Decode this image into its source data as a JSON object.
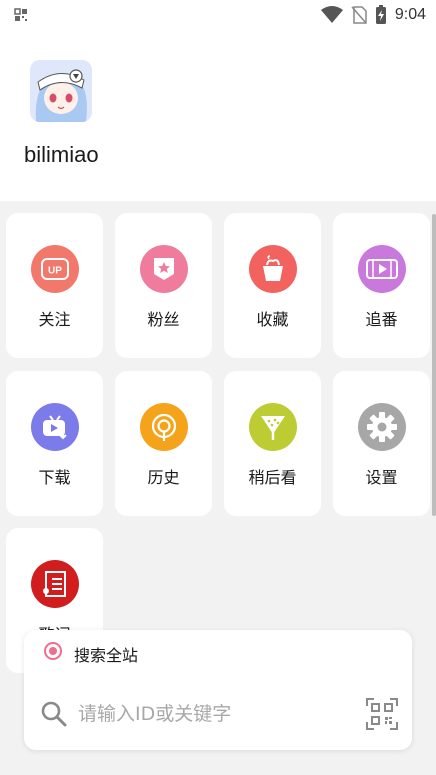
{
  "status_bar": {
    "time": "9:04"
  },
  "profile": {
    "username": "bilimiao"
  },
  "menu": [
    {
      "label": "关注",
      "icon": "up-icon",
      "color": "#f2786b"
    },
    {
      "label": "粉丝",
      "icon": "fans-badge-icon",
      "color": "#f07c9d"
    },
    {
      "label": "收藏",
      "icon": "collection-cup-icon",
      "color": "#f2635f"
    },
    {
      "label": "追番",
      "icon": "anime-film-icon",
      "color": "#c978dc"
    },
    {
      "label": "下载",
      "icon": "download-tv-icon",
      "color": "#7b7be9"
    },
    {
      "label": "历史",
      "icon": "history-icon",
      "color": "#f5a31a"
    },
    {
      "label": "稍后看",
      "icon": "watch-later-icon",
      "color": "#bccc32"
    },
    {
      "label": "设置",
      "icon": "gear-icon",
      "color": "#a7a7a7"
    },
    {
      "label": "歌词",
      "icon": "lyrics-icon",
      "color": "#d11d1d"
    }
  ],
  "search": {
    "scope_label": "搜索全站",
    "placeholder": "请输入ID或关键字"
  },
  "colors": {
    "accent": "#f06d8c"
  }
}
